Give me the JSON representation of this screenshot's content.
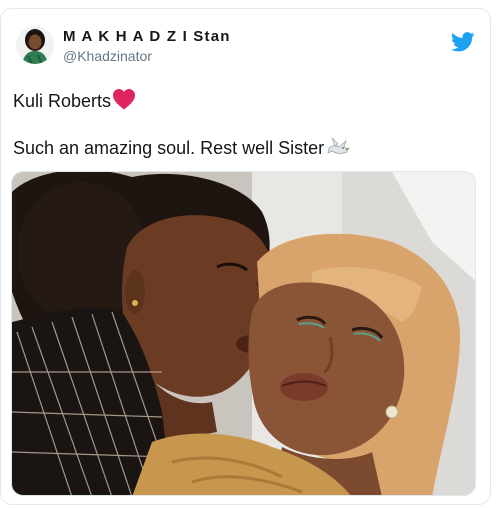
{
  "tweet": {
    "display_name": "M A K H A D Z I Stan",
    "handle": "@Khadzinator",
    "text_line1": "Kuli Roberts",
    "text_line2": "Such an amazing soul. Rest well Sister",
    "emoji": [
      "red-heart",
      "dove"
    ]
  },
  "icons": {
    "platform": "twitter-bird-icon",
    "brand_color": "#1da1f2"
  },
  "media": {
    "description_icon": "photo-two-women"
  }
}
